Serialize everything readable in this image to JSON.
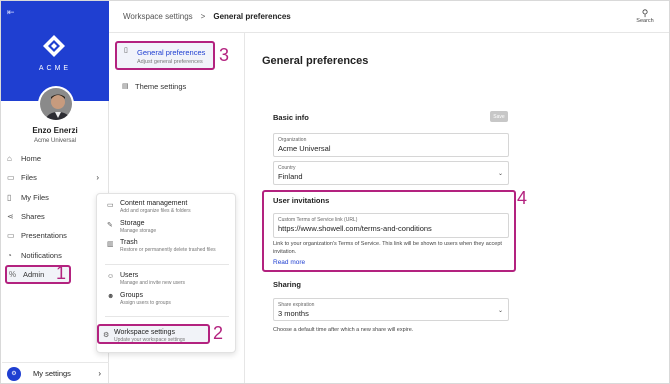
{
  "sidebar": {
    "brand_name": "ACME",
    "user_name": "Enzo Enerzi",
    "user_org": "Acme Universal",
    "items": [
      {
        "label": "Home",
        "icon": "home-icon"
      },
      {
        "label": "Files",
        "icon": "folder-icon"
      },
      {
        "label": "My Files",
        "icon": "file-icon"
      },
      {
        "label": "Shares",
        "icon": "share-icon"
      },
      {
        "label": "Presentations",
        "icon": "presentation-icon"
      },
      {
        "label": "Notifications",
        "icon": "bell-icon"
      },
      {
        "label": "Admin",
        "icon": "admin-icon"
      }
    ],
    "my_settings": "My settings"
  },
  "header": {
    "breadcrumb_parent": "Workspace settings",
    "breadcrumb_sep": ">",
    "breadcrumb_current": "General preferences",
    "search_label": "Search"
  },
  "settings_nav": [
    {
      "title": "General preferences",
      "subtitle": "Adjust general preferences"
    },
    {
      "title": "Theme settings",
      "subtitle": ""
    }
  ],
  "admin_menu": [
    {
      "title": "Content management",
      "subtitle": "Add and organize files & folders"
    },
    {
      "title": "Storage",
      "subtitle": "Manage storage"
    },
    {
      "title": "Trash",
      "subtitle": "Restore or permanently delete trashed files"
    },
    {
      "title": "Users",
      "subtitle": "Manage and invite new users"
    },
    {
      "title": "Groups",
      "subtitle": "Assign users to groups"
    },
    {
      "title": "Workspace settings",
      "subtitle": "Update your workspace settings"
    }
  ],
  "main": {
    "title": "General preferences",
    "basic_info": "Basic info",
    "save": "Save",
    "org_label": "Organization",
    "org_value": "Acme Universal",
    "country_label": "Country",
    "country_value": "Finland",
    "invitations_title": "User invitations",
    "tos_label": "Custom Terms of Service link (URL)",
    "tos_value": "https://www.showell.com/terms-and-conditions",
    "tos_help": "Link to your organization's Terms of Service. This link will be shown to users when they accept invitation.",
    "read_more": "Read more",
    "sharing_title": "Sharing",
    "expiration_label": "Share expiration",
    "expiration_value": "3 months",
    "expiration_help": "Choose a default time after which a new share will expire."
  },
  "callouts": [
    "1",
    "2",
    "3",
    "4"
  ],
  "colors": {
    "brand": "#1f3fd1",
    "highlight": "#b3227f"
  }
}
